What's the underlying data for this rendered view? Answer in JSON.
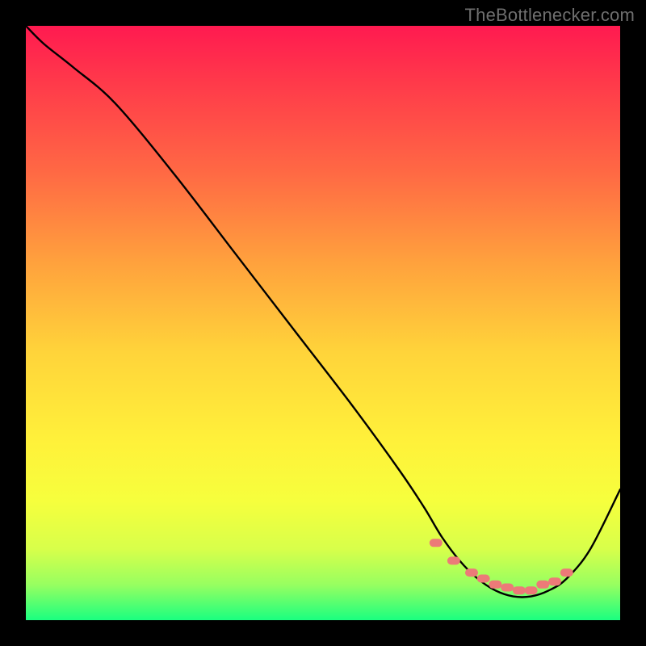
{
  "watermark": "TheBottlenecker.com",
  "chart_data": {
    "type": "line",
    "title": "",
    "xlabel": "",
    "ylabel": "",
    "xlim": [
      0,
      100
    ],
    "ylim": [
      0,
      100
    ],
    "grid": false,
    "series": [
      {
        "name": "curve",
        "x": [
          0,
          3,
          8,
          15,
          25,
          35,
          45,
          55,
          63,
          67,
          70,
          73,
          76,
          79,
          82,
          85,
          88,
          91,
          95,
          100
        ],
        "values": [
          100,
          97,
          93,
          87,
          75,
          62,
          49,
          36,
          25,
          19,
          14,
          10,
          7,
          5,
          4,
          4,
          5,
          7,
          12,
          22
        ]
      }
    ],
    "markers": {
      "name": "dots",
      "color": "#ec7a78",
      "x": [
        69,
        72,
        75,
        77,
        79,
        81,
        83,
        85,
        87,
        89,
        91
      ],
      "values": [
        13,
        10,
        8,
        7,
        6,
        5.5,
        5,
        5,
        6,
        6.5,
        8
      ]
    },
    "gradient_stops": [
      {
        "pos": 0,
        "color": "#ff1a50"
      },
      {
        "pos": 25,
        "color": "#ff6a44"
      },
      {
        "pos": 55,
        "color": "#ffd43a"
      },
      {
        "pos": 80,
        "color": "#f6ff3d"
      },
      {
        "pos": 100,
        "color": "#1aff80"
      }
    ]
  }
}
